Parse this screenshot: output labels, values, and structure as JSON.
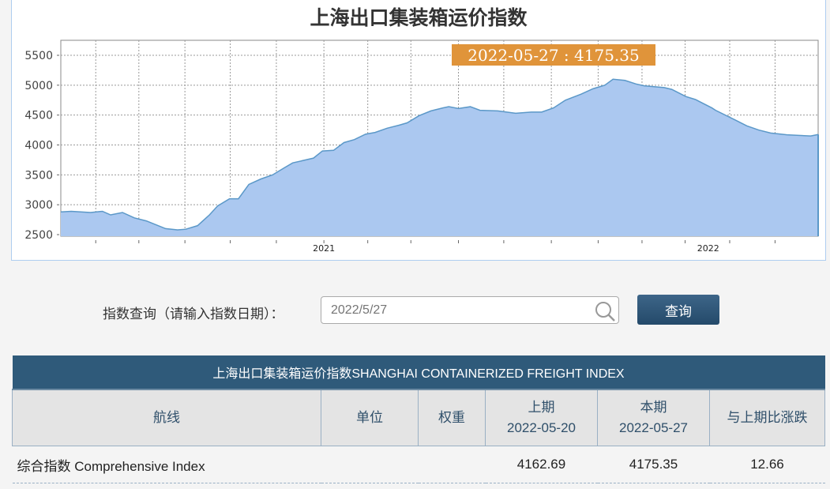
{
  "chart_data": {
    "type": "area",
    "title": "上海出口集装箱运价指数",
    "xlabel": "",
    "ylabel": "",
    "ylim": [
      2500,
      5500
    ],
    "yticks": [
      2500,
      3000,
      3500,
      4000,
      4500,
      5000,
      5500
    ],
    "xlim": [
      0,
      101.9
    ],
    "x_unit": "weeks",
    "xtick_positions": [
      4.7,
      10.5,
      16.7,
      22.8,
      29,
      35.4,
      41.3,
      47.1,
      53.5,
      59.6,
      66,
      72.3,
      78.2,
      84,
      90,
      96.1
    ],
    "year_labels": [
      {
        "label": "2021",
        "x": 35.4
      },
      {
        "label": "2022",
        "x": 87.1
      }
    ],
    "grid": true,
    "tooltip": "2022-05-27 : 4175.35",
    "points": [
      [
        0,
        2880
      ],
      [
        1.4,
        2890
      ],
      [
        4,
        2870
      ],
      [
        5.6,
        2890
      ],
      [
        6.7,
        2830
      ],
      [
        8.3,
        2870
      ],
      [
        9.9,
        2780
      ],
      [
        11.5,
        2730
      ],
      [
        14.1,
        2600
      ],
      [
        15.7,
        2580
      ],
      [
        16.8,
        2590
      ],
      [
        18.4,
        2650
      ],
      [
        20,
        2830
      ],
      [
        21.1,
        2980
      ],
      [
        22.7,
        3100
      ],
      [
        23.9,
        3100
      ],
      [
        25.3,
        3340
      ],
      [
        26.9,
        3430
      ],
      [
        28.5,
        3500
      ],
      [
        30.1,
        3620
      ],
      [
        31.2,
        3700
      ],
      [
        33.3,
        3760
      ],
      [
        34,
        3780
      ],
      [
        35.2,
        3900
      ],
      [
        36.7,
        3910
      ],
      [
        38.1,
        4040
      ],
      [
        39.5,
        4090
      ],
      [
        41,
        4180
      ],
      [
        42.3,
        4210
      ],
      [
        43.9,
        4280
      ],
      [
        45.5,
        4330
      ],
      [
        46.6,
        4370
      ],
      [
        48.2,
        4490
      ],
      [
        49.8,
        4570
      ],
      [
        51.4,
        4620
      ],
      [
        52.2,
        4640
      ],
      [
        53.5,
        4610
      ],
      [
        55.1,
        4640
      ],
      [
        56.4,
        4580
      ],
      [
        58.8,
        4570
      ],
      [
        61.2,
        4530
      ],
      [
        63.3,
        4550
      ],
      [
        64.7,
        4550
      ],
      [
        66.3,
        4620
      ],
      [
        67.9,
        4750
      ],
      [
        70,
        4850
      ],
      [
        71.6,
        4940
      ],
      [
        73.2,
        5000
      ],
      [
        74.3,
        5100
      ],
      [
        75.9,
        5080
      ],
      [
        77.4,
        5020
      ],
      [
        78.5,
        4990
      ],
      [
        81.2,
        4960
      ],
      [
        82.2,
        4930
      ],
      [
        84.1,
        4810
      ],
      [
        85.4,
        4760
      ],
      [
        87.6,
        4620
      ],
      [
        88.1,
        4580
      ],
      [
        90.7,
        4420
      ],
      [
        92.3,
        4320
      ],
      [
        93.9,
        4250
      ],
      [
        95.5,
        4200
      ],
      [
        97.7,
        4170
      ],
      [
        99.3,
        4160
      ],
      [
        100.9,
        4150
      ],
      [
        101.9,
        4175.35
      ]
    ],
    "colors": {
      "fill": "#abc8f0",
      "line": "#5b98c8",
      "tooltip": "#e0943a"
    }
  },
  "query": {
    "label": "指数查询（请输入指数日期）：",
    "value": "2022/5/27",
    "button": "查询"
  },
  "table": {
    "caption": "上海出口集装箱运价指数SHANGHAI CONTAINERIZED FREIGHT INDEX",
    "headers": {
      "route": "航线",
      "unit": "单位",
      "weight": "权重",
      "prev": "上期",
      "prev_date": "2022-05-20",
      "curr": "本期",
      "curr_date": "2022-05-27",
      "change": "与上期比涨跌"
    },
    "rows": [
      {
        "route": "综合指数 Comprehensive Index",
        "unit": "",
        "weight": "",
        "prev": "4162.69",
        "curr": "4175.35",
        "change": "12.66"
      }
    ]
  }
}
